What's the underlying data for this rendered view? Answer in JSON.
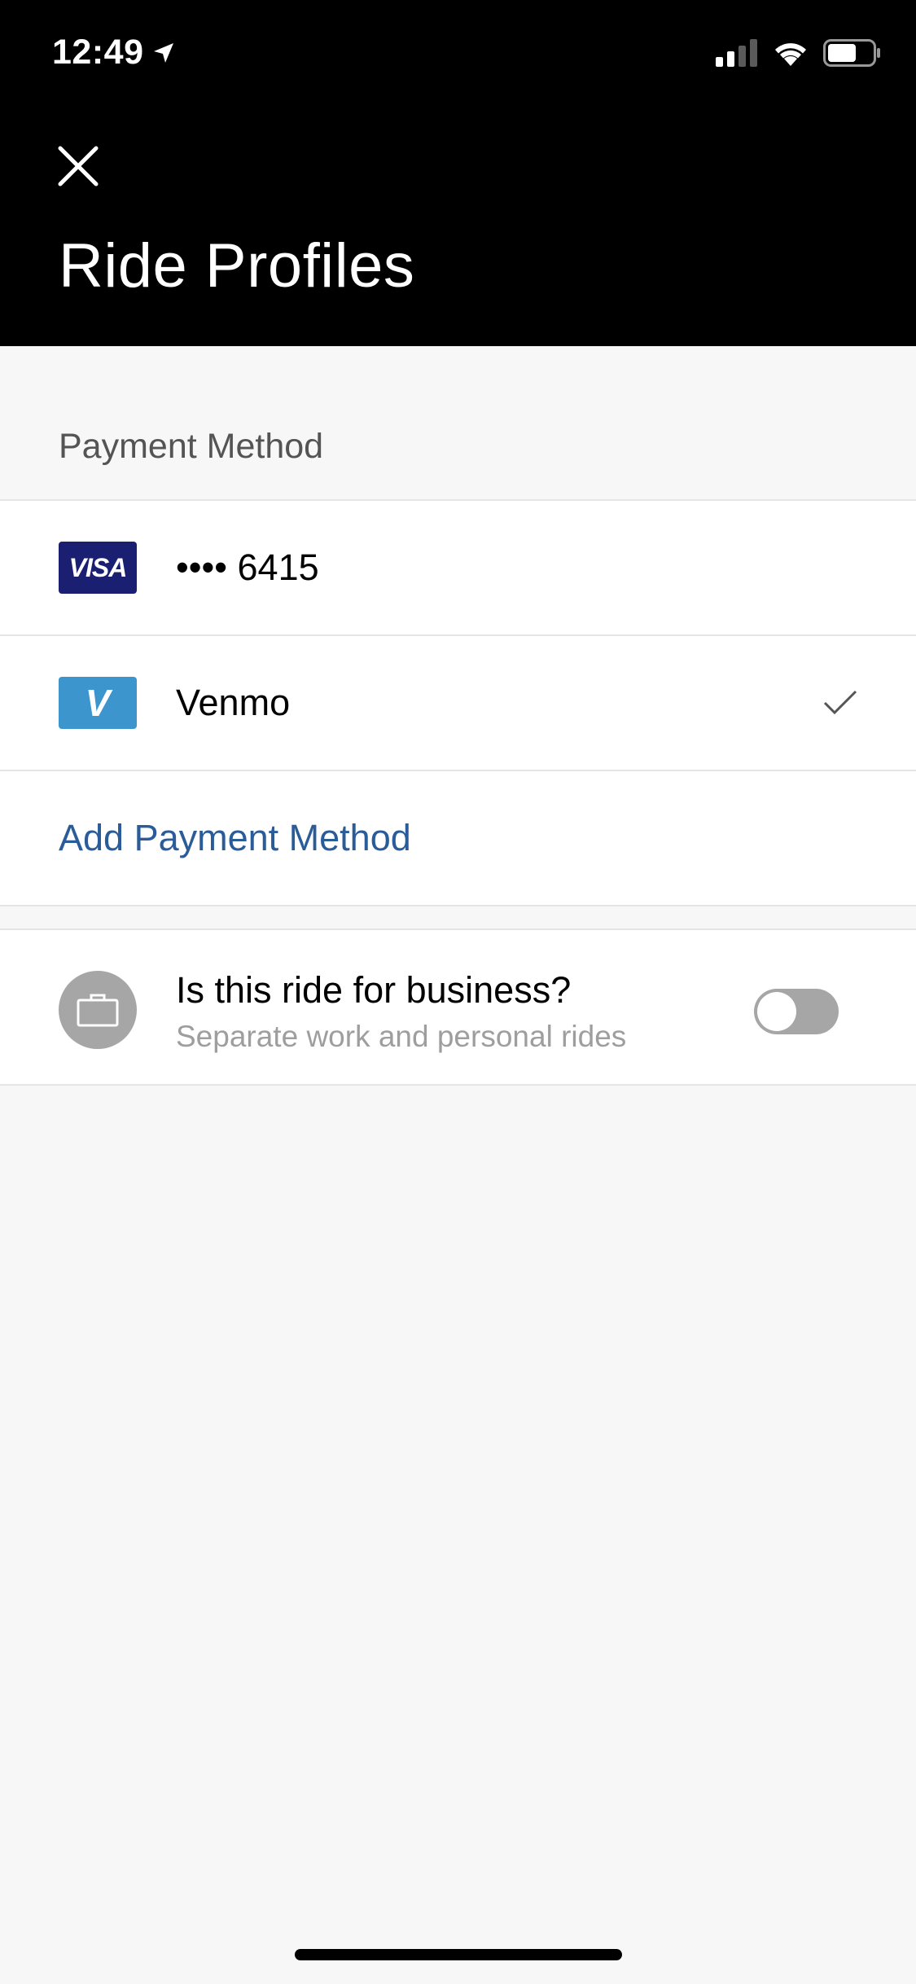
{
  "status_bar": {
    "time": "12:49"
  },
  "header": {
    "title": "Ride Profiles"
  },
  "payment": {
    "section_label": "Payment Method",
    "methods": [
      {
        "icon": "visa-card-icon",
        "brand_text": "VISA",
        "label": "•••• 6415",
        "selected": false
      },
      {
        "icon": "venmo-icon",
        "brand_text": "V",
        "label": "Venmo",
        "selected": true
      }
    ],
    "add_label": "Add Payment Method"
  },
  "business": {
    "title": "Is this ride for business?",
    "subtitle": "Separate work and personal rides",
    "toggle_on": false
  },
  "colors": {
    "header_bg": "#000000",
    "link": "#2a5c9a",
    "visa": "#1a1f71",
    "venmo": "#3d95ce",
    "toggle_off": "#a6a6a6"
  }
}
